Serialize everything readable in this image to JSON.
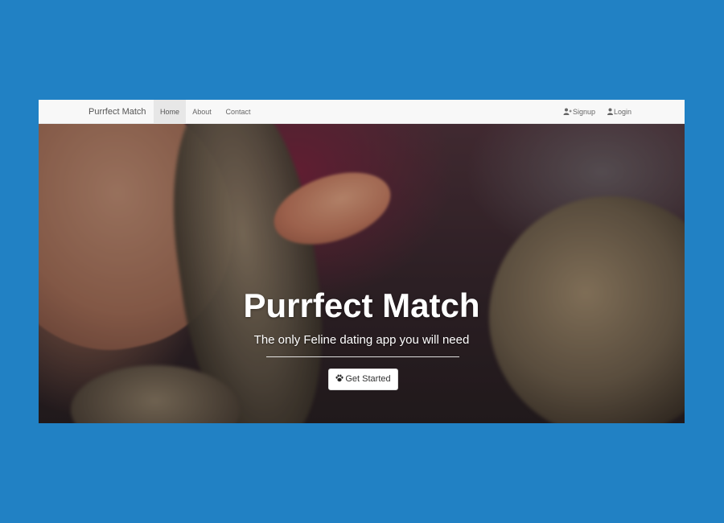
{
  "navbar": {
    "brand": "Purrfect Match",
    "links": [
      {
        "label": "Home",
        "active": true
      },
      {
        "label": "About",
        "active": false
      },
      {
        "label": "Contact",
        "active": false
      }
    ],
    "right_links": [
      {
        "label": "Signup",
        "icon": "user-plus-icon"
      },
      {
        "label": "Login",
        "icon": "user-icon"
      }
    ]
  },
  "hero": {
    "title": "Purrfect Match",
    "subtitle": "The only Feline dating app you will need",
    "cta_label": "Get Started",
    "cta_icon": "paw-icon"
  },
  "colors": {
    "page_background": "#2181c4",
    "navbar_background": "#f8f8f8",
    "active_tab_background": "#e7e7e7"
  }
}
